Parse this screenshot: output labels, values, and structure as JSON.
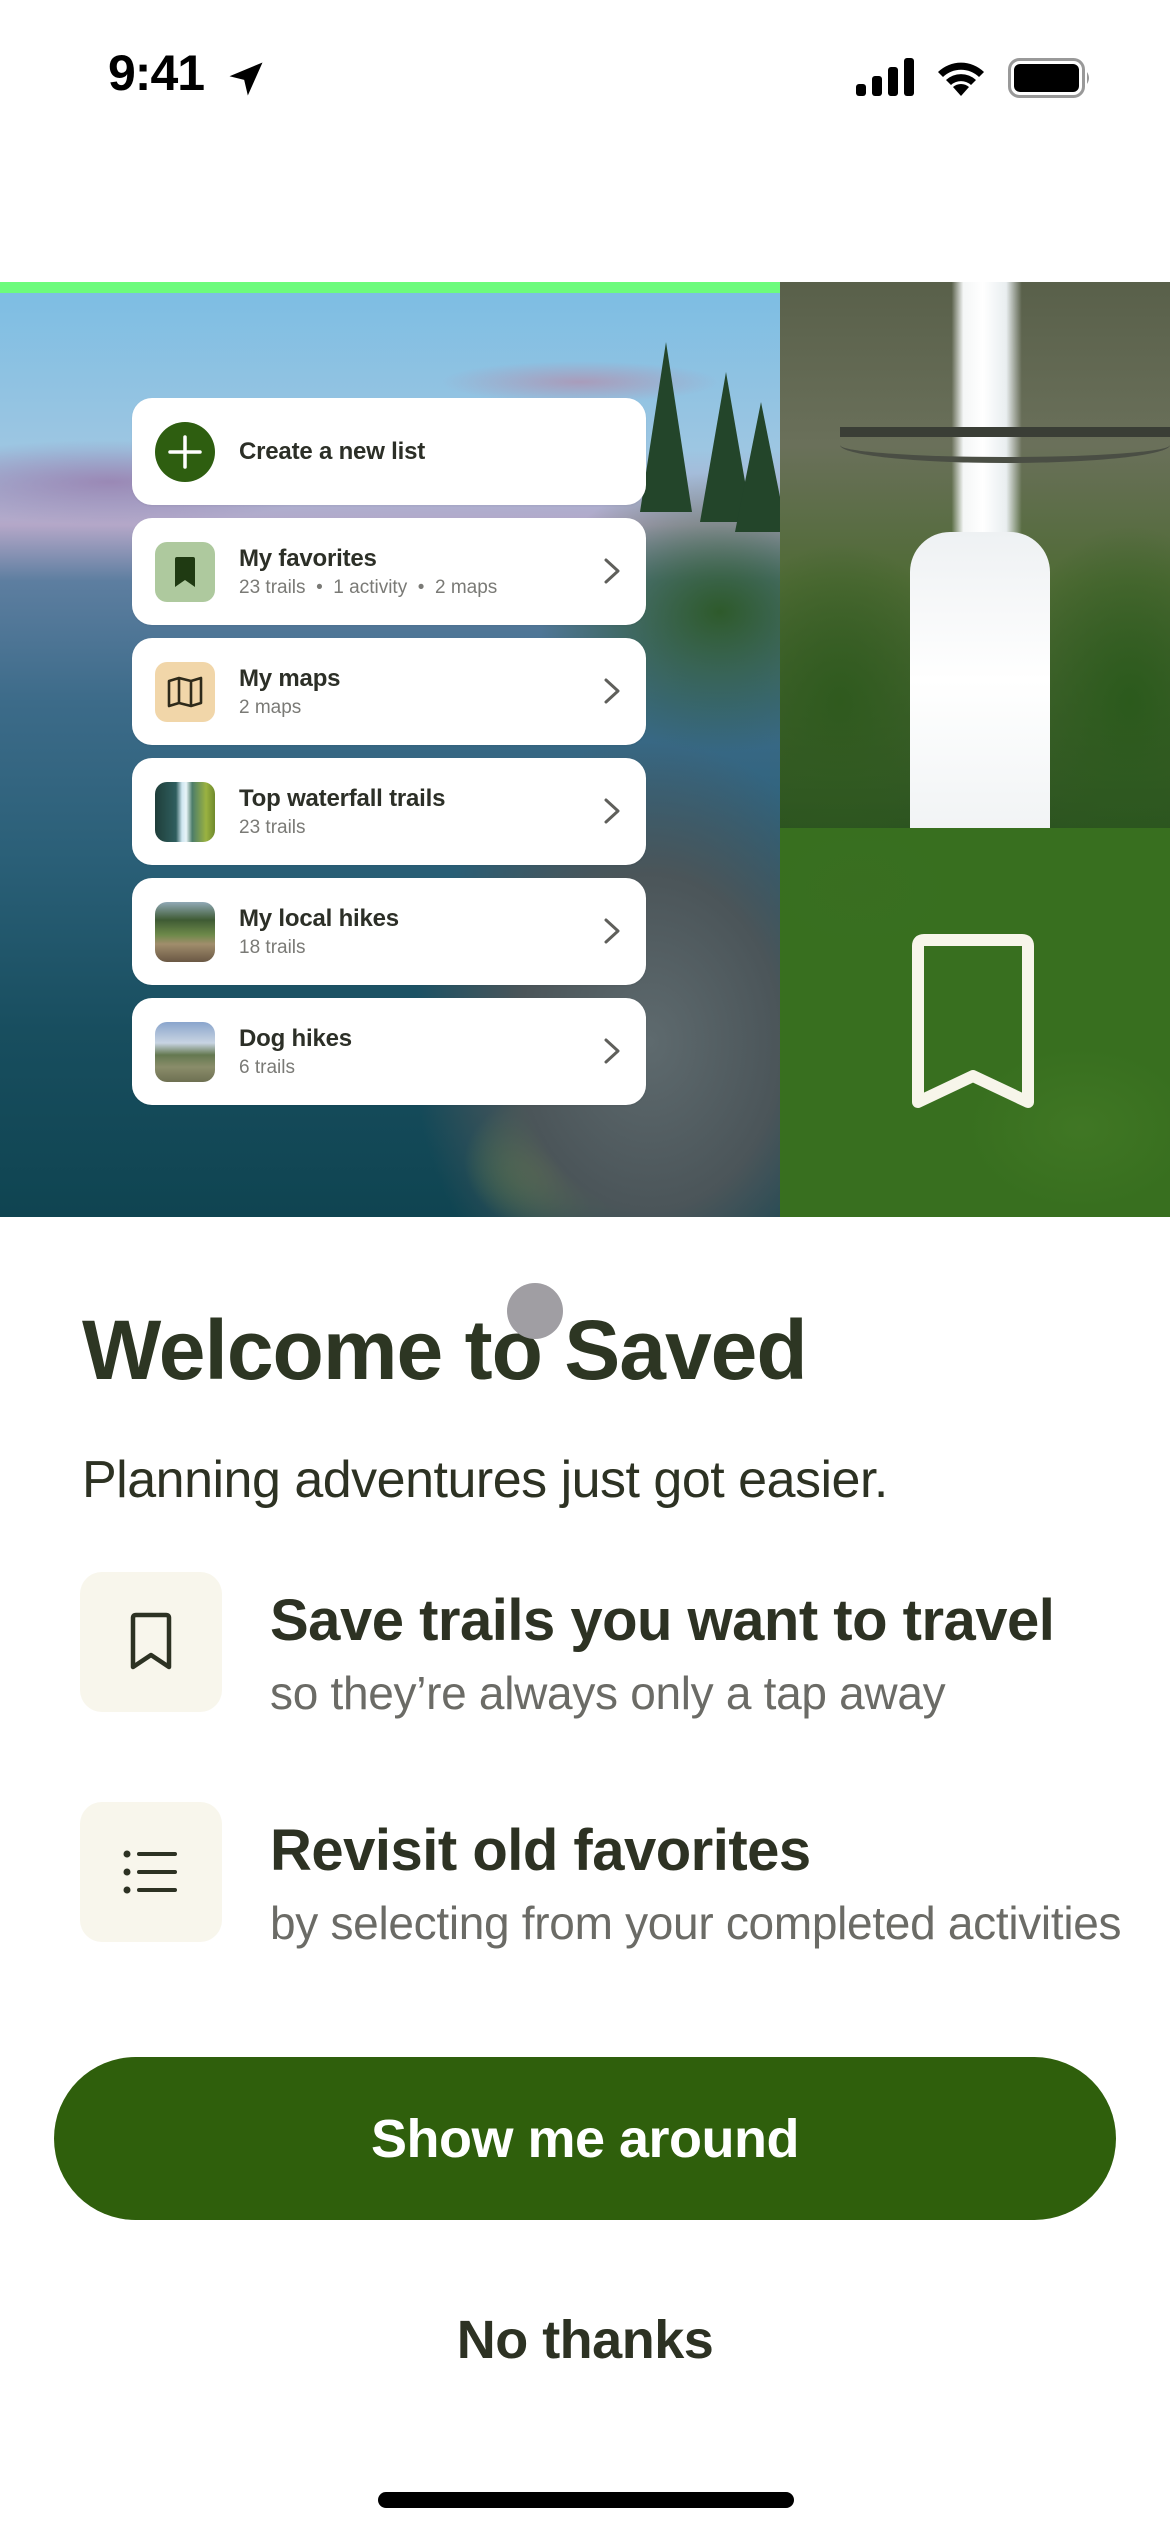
{
  "status_bar": {
    "time": "9:41",
    "icons": [
      "location-arrow-icon",
      "cellular-signal-icon",
      "wifi-icon",
      "battery-icon"
    ]
  },
  "hero": {
    "progress_fraction": 0.5,
    "colors": {
      "progress": "#6cfb7c",
      "bookmark_panel": "#386f1f"
    },
    "lists": [
      {
        "icon": "plus-icon",
        "title": "Create a new list",
        "subtitle": null,
        "has_chevron": false
      },
      {
        "icon": "bookmark-icon",
        "title": "My favorites",
        "subtitle": "23 trails  •  1 activity  •  2 maps",
        "has_chevron": true
      },
      {
        "icon": "map-icon",
        "title": "My maps",
        "subtitle": "2 maps",
        "has_chevron": true
      },
      {
        "icon": "waterfall-thumbnail",
        "title": "Top waterfall trails",
        "subtitle": "23 trails",
        "has_chevron": true
      },
      {
        "icon": "creek-thumbnail",
        "title": "My local hikes",
        "subtitle": "18 trails",
        "has_chevron": true
      },
      {
        "icon": "meadow-thumbnail",
        "title": "Dog hikes",
        "subtitle": "6 trails",
        "has_chevron": true
      }
    ]
  },
  "content": {
    "title": "Welcome to Saved",
    "subtitle": "Planning adventures just got easier.",
    "features": [
      {
        "icon": "bookmark-outline-icon",
        "title": "Save trails you want to travel",
        "description": "so they’re always only a tap away"
      },
      {
        "icon": "list-icon",
        "title": "Revisit old favorites",
        "description": "by selecting from your completed activities"
      }
    ]
  },
  "actions": {
    "primary_label": "Show me around",
    "secondary_label": "No thanks",
    "primary_color": "#2f5f0c"
  }
}
